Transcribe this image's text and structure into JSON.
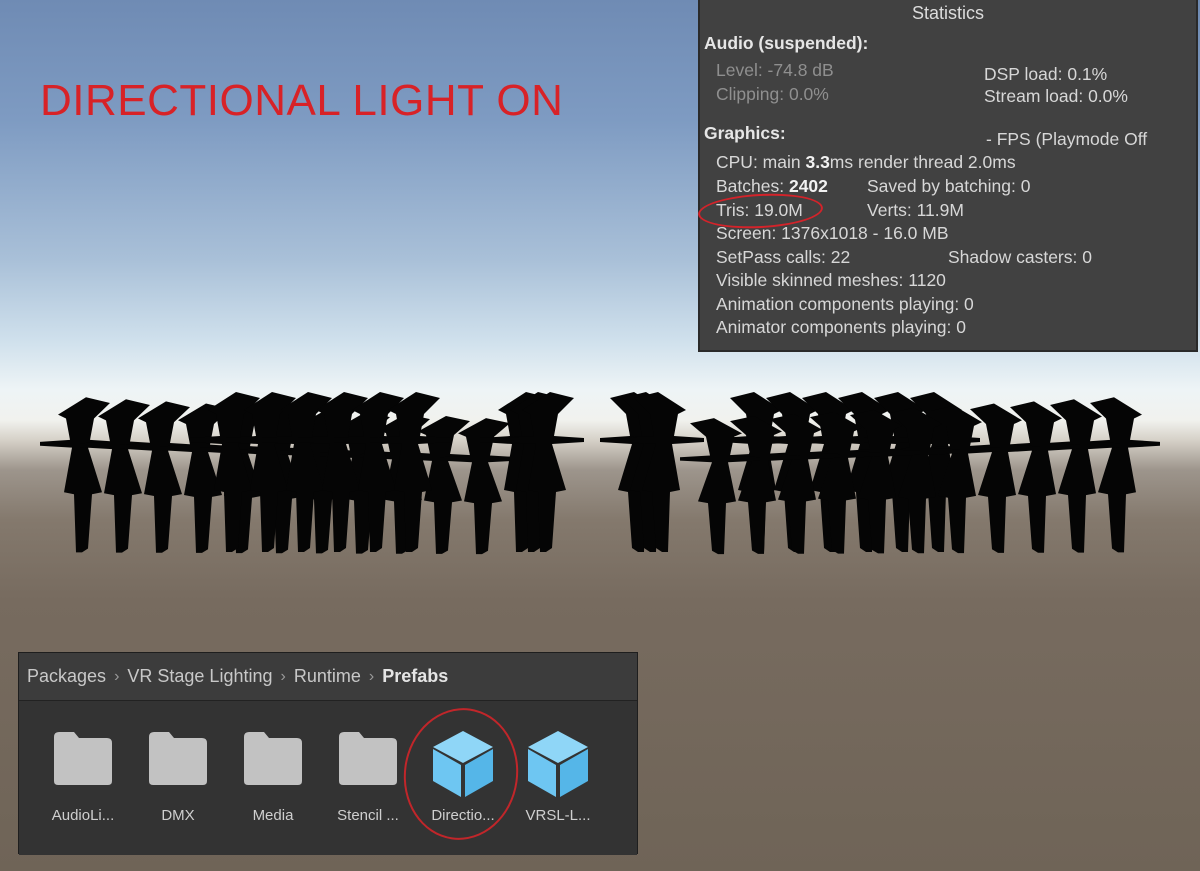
{
  "overlay": {
    "title": "DIRECTIONAL LIGHT ON",
    "title_color": "#d82227"
  },
  "stats": {
    "header": "Statistics",
    "audio": {
      "title": "Audio (suspended):",
      "level": "Level: -74.8 dB",
      "clipping": "Clipping: 0.0%",
      "dsp_load": "DSP load: 0.1%",
      "stream_load": "Stream load: 0.0%"
    },
    "graphics": {
      "title": "Graphics:",
      "fps": "- FPS (Playmode Off",
      "cpu_prefix": "CPU: main ",
      "cpu_main": "3.3",
      "cpu_suffix": "ms  render thread 2.0ms",
      "batches_prefix": "Batches: ",
      "batches": "2402",
      "saved_by_batching": "Saved by batching: 0",
      "tris": "Tris: 19.0M",
      "verts": "Verts: 11.9M",
      "screen": "Screen: 1376x1018 - 16.0 MB",
      "setpass": "SetPass calls: 22",
      "shadow_casters": "Shadow casters: 0",
      "skinned_meshes": "Visible skinned meshes: 1120",
      "animation_components": "Animation components playing: 0",
      "animator_components": "Animator components playing: 0"
    }
  },
  "project": {
    "breadcrumb": [
      "Packages",
      "VR Stage Lighting",
      "Runtime",
      "Prefabs"
    ],
    "separator": "›",
    "items": [
      {
        "label": "AudioLi...",
        "icon": "folder-icon"
      },
      {
        "label": "DMX",
        "icon": "folder-icon"
      },
      {
        "label": "Media",
        "icon": "folder-icon"
      },
      {
        "label": "Stencil ...",
        "icon": "folder-icon"
      },
      {
        "label": "Directio...",
        "icon": "prefab-icon"
      },
      {
        "label": "VRSL-L...",
        "icon": "prefab-icon"
      }
    ],
    "prefab_color": "#6ec6f2",
    "folder_color": "#c2c2c2"
  },
  "annotation_color": "#d3232a"
}
